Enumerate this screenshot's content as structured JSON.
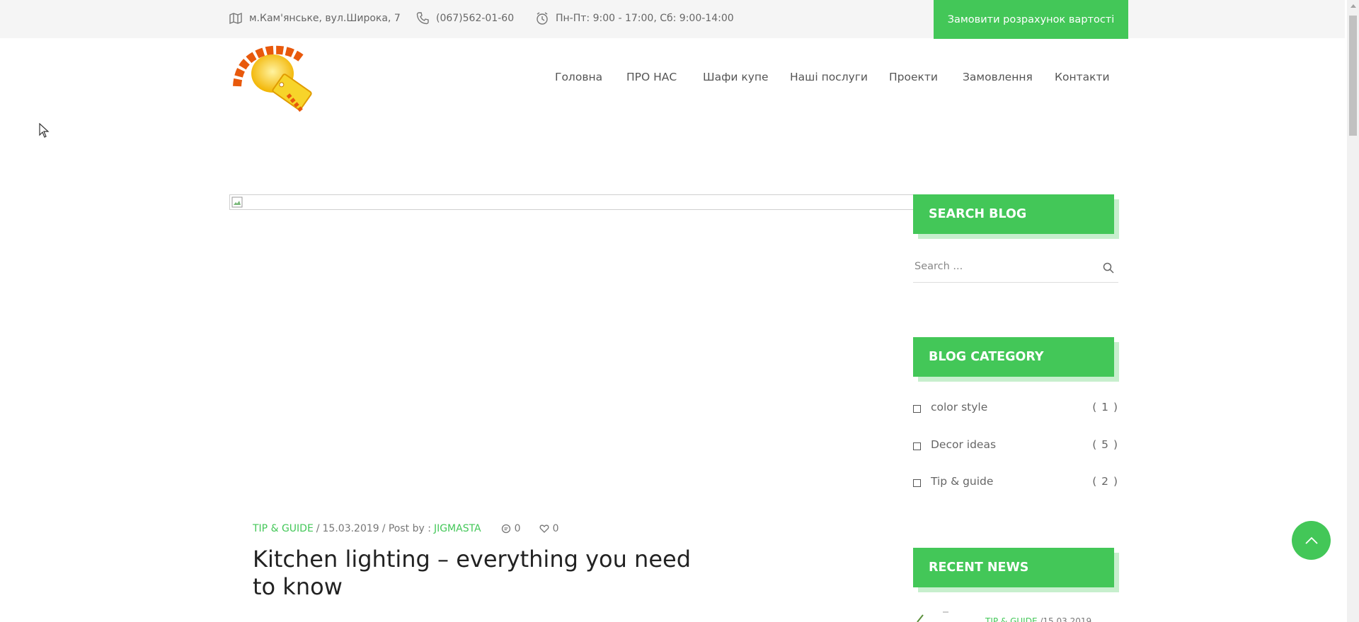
{
  "topbar": {
    "address": "м.Кам'янське, вул.Широка, 7",
    "phone": "(067)562-01-60",
    "hours": "Пн-Пт: 9:00 - 17:00, Сб: 9:00-14:00",
    "cta_label": "Замовити розрахунок вартості",
    "icons": [
      "map-icon",
      "phone-icon",
      "clock-icon"
    ]
  },
  "nav": {
    "items": [
      "Головна",
      "ПРО НАС",
      "Шафи купе",
      "Наші послуги",
      "Проекти",
      "Замовлення",
      "Контакти"
    ]
  },
  "post": {
    "category": "TIP & GUIDE",
    "separator1": "/",
    "date": "15.03.2019",
    "separator2": "/ Post by :",
    "author": "JIGMASTA",
    "comments": "0",
    "likes": "0",
    "title": "Kitchen lighting – everything you need to know"
  },
  "sidebar": {
    "search_title": "SEARCH BLOG",
    "search_placeholder": "Search ...",
    "category_title": "BLOG CATEGORY",
    "categories": [
      {
        "name": "color style",
        "count": "( 1 )"
      },
      {
        "name": "Decor ideas",
        "count": "( 5 )"
      },
      {
        "name": "Tip & guide",
        "count": "( 2 )"
      }
    ],
    "recent_title": "RECENT NEWS",
    "recent_first": {
      "category": "TIP & GUIDE",
      "date": "/15.03.2019"
    }
  },
  "colors": {
    "accent": "#43c758",
    "accent_shadow": "#c7efcd",
    "topbar_bg": "#f5f5f5"
  }
}
